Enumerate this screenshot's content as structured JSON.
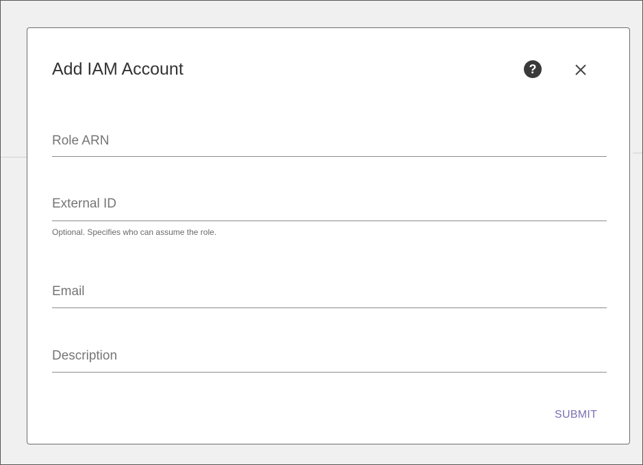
{
  "dialog": {
    "title": "Add IAM Account",
    "help_icon": "question-circle-icon",
    "help_glyph": "?",
    "close_icon": "close-icon",
    "submit_label": "SUBMIT"
  },
  "fields": {
    "role_arn": {
      "placeholder": "Role ARN",
      "value": ""
    },
    "external_id": {
      "placeholder": "External ID",
      "value": "",
      "helper": "Optional. Specifies who can assume the role."
    },
    "email": {
      "placeholder": "Email",
      "value": ""
    },
    "description": {
      "placeholder": "Description",
      "value": ""
    }
  },
  "colors": {
    "accent": "#7b6fb0",
    "text": "#333333",
    "placeholder": "#757575",
    "backdrop": "#f0f0f0"
  }
}
